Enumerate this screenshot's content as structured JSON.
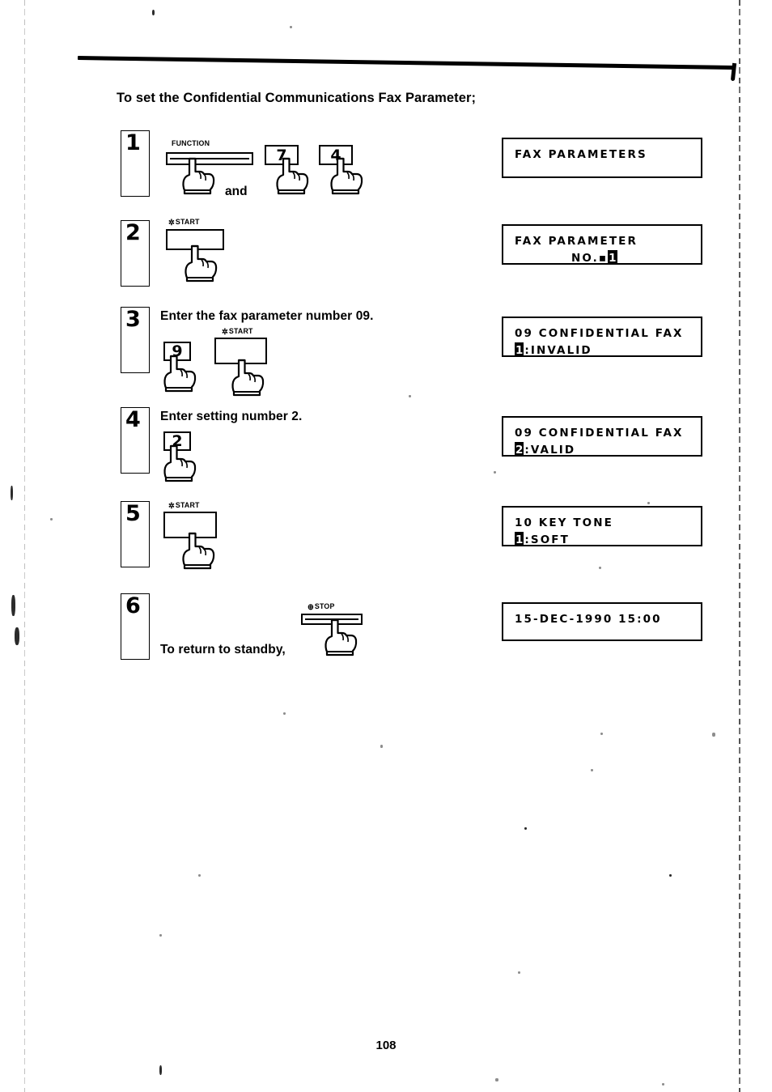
{
  "document": {
    "intro_text": "To set the Confidential Communications Fax Parameter;",
    "page_number": "108"
  },
  "keys": {
    "function_label": "FUNCTION",
    "start_label": "START",
    "stop_label": "STOP",
    "start_symbol": "✲",
    "stop_symbol": "⊕",
    "digit_7": "7",
    "digit_4": "4",
    "digit_9": "9",
    "digit_2": "2",
    "and_word": "and"
  },
  "steps": [
    {
      "number": "1",
      "instruction": "",
      "keys": [
        "FUNCTION",
        "7",
        "4"
      ]
    },
    {
      "number": "2",
      "instruction": "",
      "keys": [
        "START"
      ]
    },
    {
      "number": "3",
      "instruction": "Enter the fax parameter number 09.",
      "keys": [
        "9",
        "START"
      ]
    },
    {
      "number": "4",
      "instruction": "Enter setting number 2.",
      "keys": [
        "2"
      ]
    },
    {
      "number": "5",
      "instruction": "",
      "keys": [
        "START"
      ]
    },
    {
      "number": "6",
      "instruction": "To return to standby,",
      "keys": [
        "STOP"
      ]
    }
  ],
  "displays": [
    {
      "name": "fax-parameters",
      "line1": "FAX PARAMETERS",
      "line2": "",
      "cursor": ""
    },
    {
      "name": "fax-parameter-no",
      "line1": "FAX PARAMETER",
      "line2_prefix": "NO.▪",
      "cursor": "1"
    },
    {
      "name": "confidential-fax-invalid",
      "line1": "09 CONFIDENTIAL FAX",
      "cursor": "1",
      "line2_suffix": ":INVALID"
    },
    {
      "name": "confidential-fax-valid",
      "line1": "09 CONFIDENTIAL FAX",
      "cursor": "2",
      "line2_suffix": ":VALID"
    },
    {
      "name": "key-tone-soft",
      "line1": "10 KEY TONE",
      "cursor": "1",
      "line2_suffix": ":SOFT"
    },
    {
      "name": "standby-clock",
      "line1": "15-DEC-1990 15:00",
      "line2": "",
      "cursor": ""
    }
  ]
}
